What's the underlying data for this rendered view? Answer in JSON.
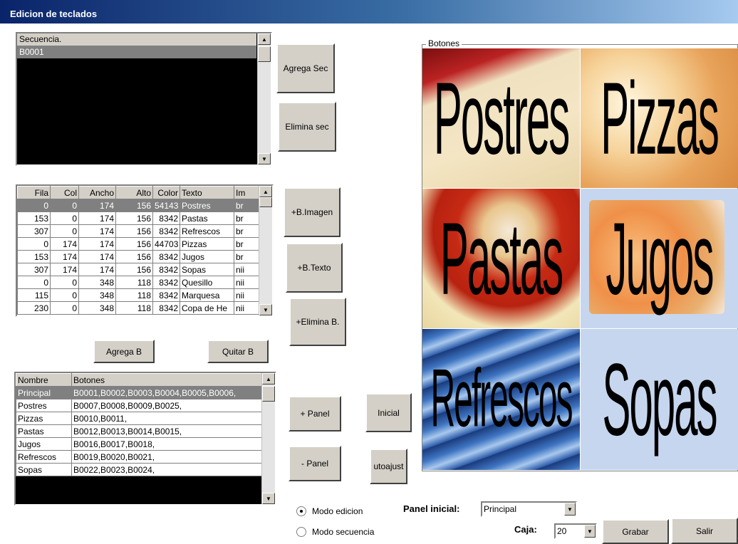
{
  "window": {
    "title": "Edicion de teclados"
  },
  "sequences": {
    "header": "Secuencia.",
    "items": [
      "B0001"
    ],
    "add_button": "Agrega Sec",
    "delete_button": "Elimina sec"
  },
  "buttons_grid": {
    "columns": [
      "Fila",
      "Col",
      "Ancho",
      "Alto",
      "Color",
      "Texto",
      "Im"
    ],
    "rows": [
      [
        "0",
        "0",
        "174",
        "156",
        "54143",
        "Postres",
        "br"
      ],
      [
        "153",
        "0",
        "174",
        "156",
        "8342",
        "Pastas",
        "br"
      ],
      [
        "307",
        "0",
        "174",
        "156",
        "8342",
        "Refrescos",
        "br"
      ],
      [
        "0",
        "174",
        "174",
        "156",
        "44703",
        "Pizzas",
        "br"
      ],
      [
        "153",
        "174",
        "174",
        "156",
        "8342",
        "Jugos",
        "br"
      ],
      [
        "307",
        "174",
        "174",
        "156",
        "8342",
        "Sopas",
        "nii"
      ],
      [
        "0",
        "0",
        "348",
        "118",
        "8342",
        "Quesillo",
        "nii"
      ],
      [
        "115",
        "0",
        "348",
        "118",
        "8342",
        "Marquesa",
        "nii"
      ],
      [
        "230",
        "0",
        "348",
        "118",
        "8342",
        "Copa de He",
        "nii"
      ]
    ]
  },
  "side_buttons": {
    "add_image": "+B.Imagen",
    "add_text": "+B.Texto",
    "delete_button": "+Elimina B.",
    "add_b": "Agrega B",
    "remove_b": "Quitar B",
    "add_panel": "+ Panel",
    "remove_panel": "- Panel",
    "initial": "Inicial",
    "autofit": "utoajust"
  },
  "panels": {
    "columns": [
      "Nombre",
      "Botones"
    ],
    "rows": [
      [
        "Principal",
        "B0001,B0002,B0003,B0004,B0005,B0006,"
      ],
      [
        "Postres",
        "B0007,B0008,B0009,B0025,"
      ],
      [
        "Pizzas",
        "B0010,B0011,"
      ],
      [
        "Pastas",
        "B0012,B0013,B0014,B0015,"
      ],
      [
        "Jugos",
        "B0016,B0017,B0018,"
      ],
      [
        "Refrescos",
        "B0019,B0020,B0021,"
      ],
      [
        "Sopas",
        "B0022,B0023,B0024,"
      ]
    ]
  },
  "preview": {
    "group_label": "Botones",
    "tiles": [
      "Postres",
      "Pizzas",
      "Pastas",
      "Jugos",
      "Refrescos",
      "Sopas"
    ]
  },
  "mode": {
    "edit_label": "Modo edicion",
    "sequence_label": "Modo secuencia",
    "selected": "Modo edicion"
  },
  "panel_inicial": {
    "label": "Panel inicial:",
    "value": "Principal"
  },
  "caja": {
    "label": "Caja:",
    "value": "20"
  },
  "footer": {
    "save": "Grabar",
    "exit": "Salir"
  }
}
